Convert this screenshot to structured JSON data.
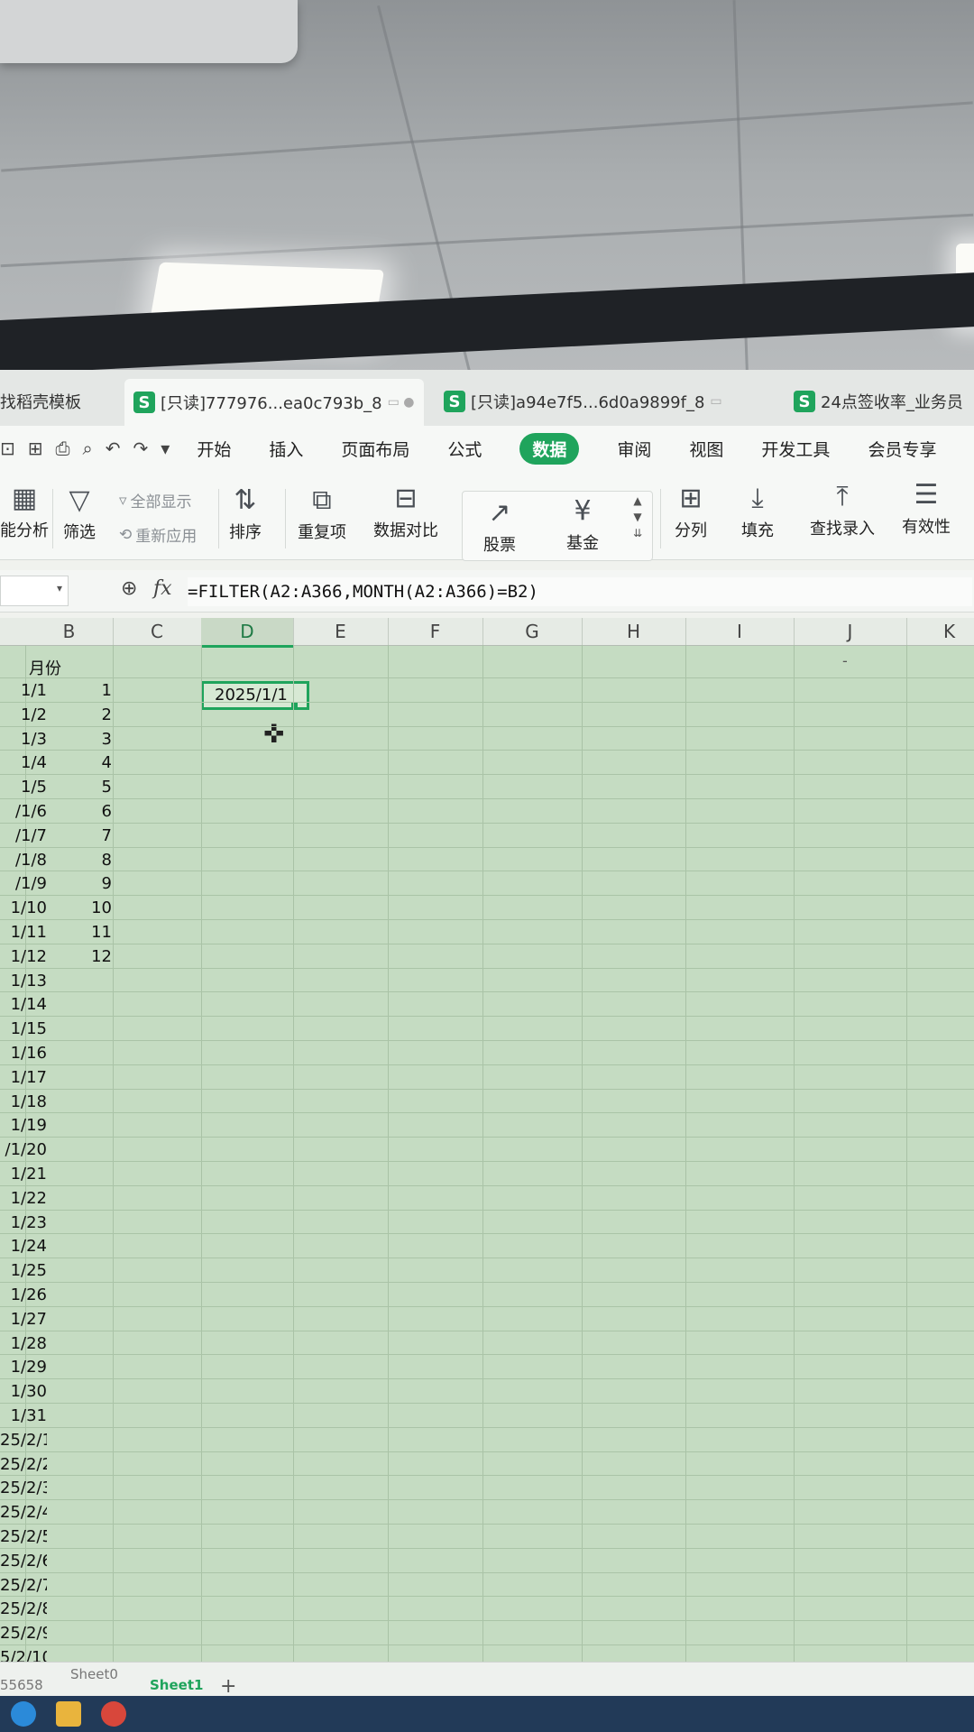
{
  "tabs": [
    {
      "label": "找稻壳模板"
    },
    {
      "label": "[只读]777976...ea0c793b_8"
    },
    {
      "label": "[只读]a94e7f5...6d0a9899f_8"
    },
    {
      "label": "24点签收率_业务员"
    }
  ],
  "menu": [
    "开始",
    "插入",
    "页面布局",
    "公式",
    "数据",
    "审阅",
    "视图",
    "开发工具",
    "会员专享"
  ],
  "ribbon": {
    "analysis": "能分析",
    "filter": "筛选",
    "show_all": "全部显示",
    "reapply": "重新应用",
    "sort": "排序",
    "duplicates": "重复项",
    "compare": "数据对比",
    "stock": "股票",
    "fund": "基金",
    "split": "分列",
    "fill": "填充",
    "lookup": "查找录入",
    "validity": "有效性"
  },
  "formula_bar": {
    "fx": "fx",
    "formula": "=FILTER(A2:A366,MONTH(A2:A366)=B2)"
  },
  "columns": [
    "B",
    "C",
    "D",
    "E",
    "F",
    "G",
    "H",
    "I",
    "J",
    "K"
  ],
  "selected_column": "D",
  "header_b": "月份",
  "rows": [
    {
      "a": "1/1",
      "b": "1"
    },
    {
      "a": "1/2",
      "b": "2"
    },
    {
      "a": "1/3",
      "b": "3"
    },
    {
      "a": "1/4",
      "b": "4"
    },
    {
      "a": "1/5",
      "b": "5"
    },
    {
      "a": "/1/6",
      "b": "6"
    },
    {
      "a": "/1/7",
      "b": "7"
    },
    {
      "a": "/1/8",
      "b": "8"
    },
    {
      "a": "/1/9",
      "b": "9"
    },
    {
      "a": "1/10",
      "b": "10"
    },
    {
      "a": "1/11",
      "b": "11"
    },
    {
      "a": "1/12",
      "b": "12"
    },
    {
      "a": "1/13",
      "b": ""
    },
    {
      "a": "1/14",
      "b": ""
    },
    {
      "a": "1/15",
      "b": ""
    },
    {
      "a": "1/16",
      "b": ""
    },
    {
      "a": "1/17",
      "b": ""
    },
    {
      "a": "1/18",
      "b": ""
    },
    {
      "a": "1/19",
      "b": ""
    },
    {
      "a": "/1/20",
      "b": ""
    },
    {
      "a": "1/21",
      "b": ""
    },
    {
      "a": "1/22",
      "b": ""
    },
    {
      "a": "1/23",
      "b": ""
    },
    {
      "a": "1/24",
      "b": ""
    },
    {
      "a": "1/25",
      "b": ""
    },
    {
      "a": "1/26",
      "b": ""
    },
    {
      "a": "1/27",
      "b": ""
    },
    {
      "a": "1/28",
      "b": ""
    },
    {
      "a": "1/29",
      "b": ""
    },
    {
      "a": "1/30",
      "b": ""
    },
    {
      "a": "1/31",
      "b": ""
    },
    {
      "a": "25/2/1",
      "b": ""
    },
    {
      "a": "25/2/2",
      "b": ""
    },
    {
      "a": "25/2/3",
      "b": ""
    },
    {
      "a": "25/2/4",
      "b": ""
    },
    {
      "a": "25/2/5",
      "b": ""
    },
    {
      "a": "25/2/6",
      "b": ""
    },
    {
      "a": "25/2/7",
      "b": ""
    },
    {
      "a": "25/2/8",
      "b": ""
    },
    {
      "a": "25/2/9",
      "b": ""
    },
    {
      "a": "5/2/10",
      "b": ""
    }
  ],
  "active_cell_value": "2025/1/1",
  "sheets": {
    "left_number": "55658",
    "sheet0": "Sheet0",
    "sheet1": "Sheet1",
    "add": "+"
  },
  "colors": {
    "accent": "#1fa45c",
    "grid_bg": "#c5dcc2"
  }
}
